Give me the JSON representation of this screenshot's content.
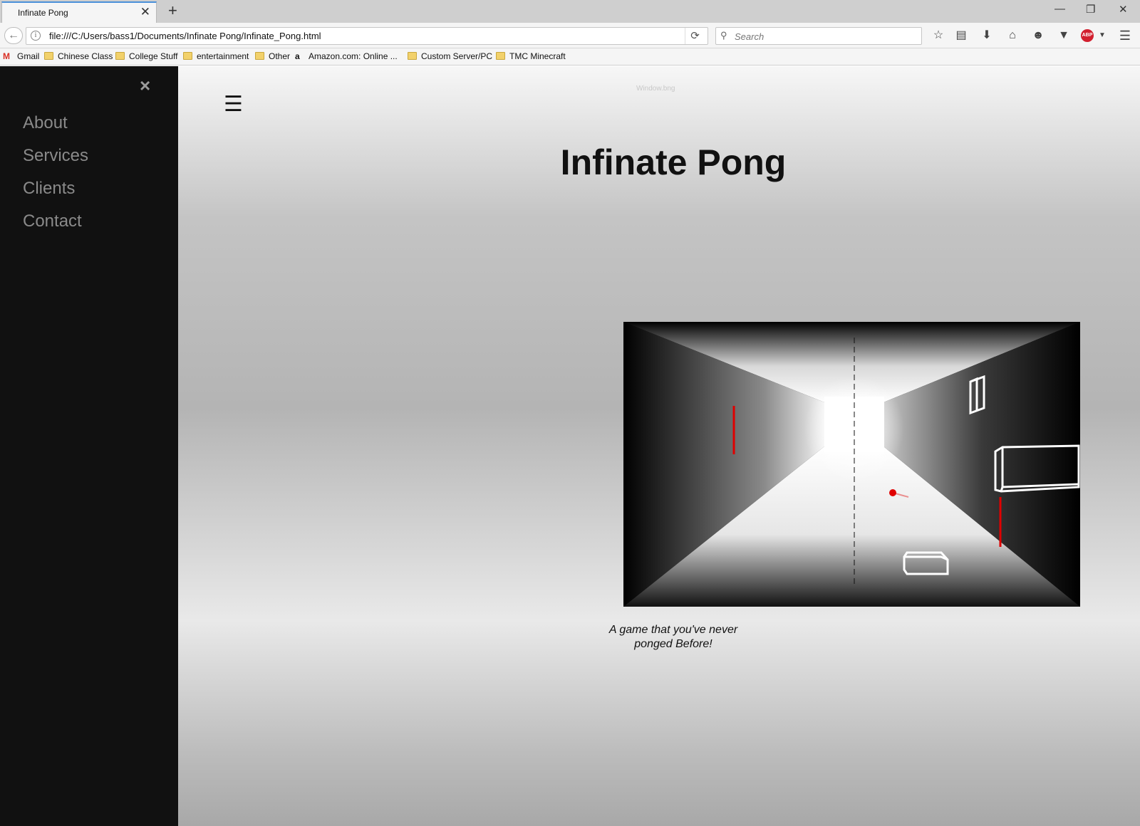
{
  "browser": {
    "tab_title": "Infinate Pong",
    "tab_close": "✕",
    "new_tab": "+",
    "url": "file:///C:/Users/bass1/Documents/Infinate Pong/Infinate_Pong.html",
    "search_placeholder": "Search",
    "window_controls": {
      "minimize": "—",
      "restore": "❐",
      "close": "✕"
    }
  },
  "bookmarks": [
    {
      "label": "Gmail",
      "icon": "gmail-icon"
    },
    {
      "label": "Chinese Class",
      "icon": "folder-icon"
    },
    {
      "label": "College Stuff",
      "icon": "folder-icon"
    },
    {
      "label": "entertainment",
      "icon": "folder-icon"
    },
    {
      "label": "Other",
      "icon": "folder-icon"
    },
    {
      "label": "Amazon.com: Online ...",
      "icon": "amazon-icon"
    },
    {
      "label": "Custom Server/PC",
      "icon": "folder-icon"
    },
    {
      "label": "TMC Minecraft",
      "icon": "folder-icon"
    }
  ],
  "sidenav": {
    "close": "×",
    "items": [
      "About",
      "Services",
      "Clients",
      "Contact"
    ]
  },
  "page": {
    "menu_icon": "☰",
    "faint_text": "Window.bng",
    "title": "Infinate Pong",
    "caption_line1": "A game that you've never",
    "caption_line2": "ponged Before!"
  },
  "colors": {
    "sidenav_bg": "#111111",
    "paddle": "#e00000",
    "ball": "#e00000",
    "wireframe": "#ffffff"
  }
}
